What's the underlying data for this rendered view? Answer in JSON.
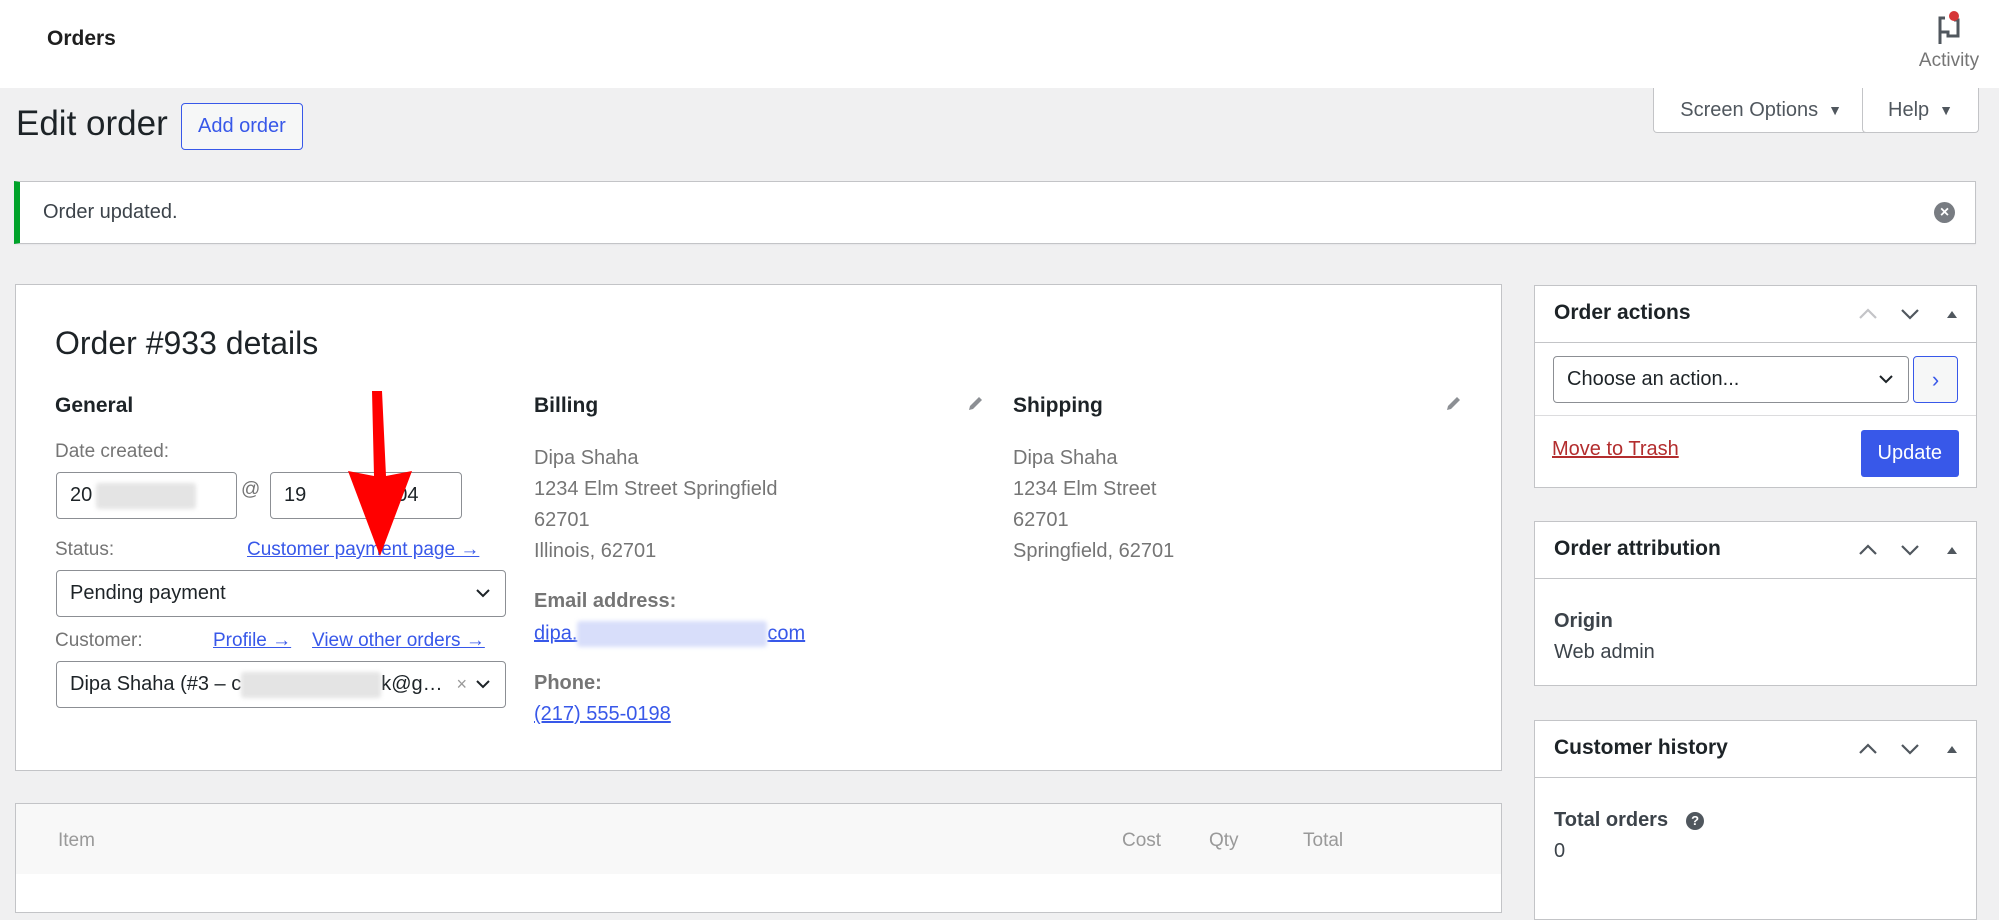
{
  "topbar": {
    "title": "Orders",
    "activity_label": "Activity",
    "activity_icon": "flag-icon"
  },
  "tabs": {
    "screen_options": "Screen Options",
    "help": "Help"
  },
  "header": {
    "page_title": "Edit order",
    "add_order": "Add order"
  },
  "notice": {
    "message": "Order updated.",
    "accent": "#00a32a"
  },
  "order": {
    "heading": "Order #933 details",
    "general": {
      "title": "General",
      "date_label": "Date created:",
      "date_value_visible": "20",
      "at_symbol": "@",
      "hour_visible": "19",
      "minute_visible": "04",
      "status_label": "Status:",
      "payment_link": "Customer payment page →",
      "status_value": "Pending payment",
      "customer_label": "Customer:",
      "profile_link": "Profile →",
      "other_orders_link": "View other orders →",
      "customer_prefix": "Dipa Shaha (#3 – c",
      "customer_suffix": "k@g…",
      "clear_symbol": "×"
    },
    "billing": {
      "title": "Billing",
      "lines": [
        "Dipa Shaha",
        "1234 Elm Street Springfield",
        "62701",
        "Illinois, 62701"
      ],
      "email_label": "Email address:",
      "email_prefix": "dipa.",
      "email_suffix": "com",
      "phone_label": "Phone:",
      "phone": "(217) 555-0198"
    },
    "shipping": {
      "title": "Shipping",
      "lines": [
        "Dipa Shaha",
        "1234 Elm Street",
        "62701",
        "Springfield, 62701"
      ]
    }
  },
  "items_table": {
    "columns": [
      "Item",
      "Cost",
      "Qty",
      "Total"
    ]
  },
  "sidebar": {
    "order_actions": {
      "title": "Order actions",
      "select_value": "Choose an action...",
      "go_symbol": "›",
      "trash": "Move to Trash",
      "update": "Update"
    },
    "attribution": {
      "title": "Order attribution",
      "origin_label": "Origin",
      "origin_value": "Web admin"
    },
    "customer_history": {
      "title": "Customer history",
      "total_orders_label": "Total orders",
      "total_orders_value": "0"
    }
  },
  "colors": {
    "accent": "#3858e9",
    "danger": "#b32d2e",
    "annotation_arrow": "#ff0000"
  }
}
